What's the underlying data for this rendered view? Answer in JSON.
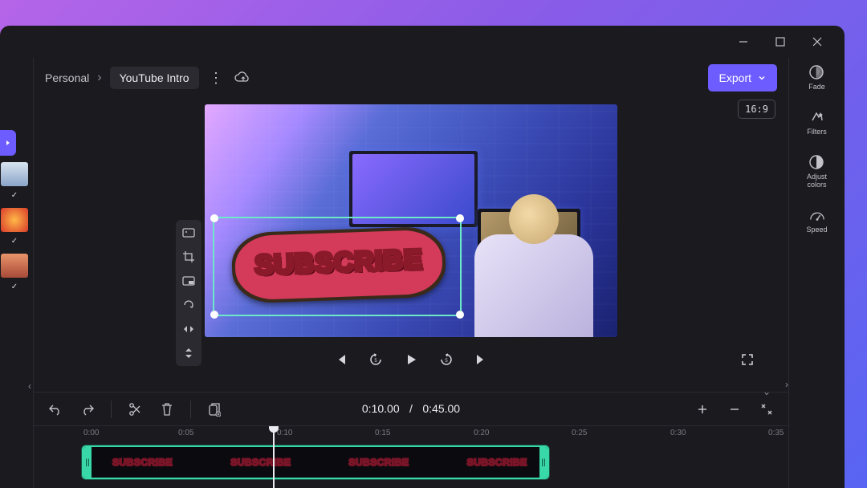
{
  "breadcrumb": {
    "root": "Personal",
    "current": "YouTube Intro"
  },
  "export_label": "Export",
  "aspect_ratio": "16:9",
  "sticker_text": "SUBSCRIBE",
  "playback": {
    "current": "0:10.00",
    "separator": "/",
    "total": "0:45.00"
  },
  "right_panel": {
    "fade": "Fade",
    "filters": "Filters",
    "adjust": "Adjust\ncolors",
    "speed": "Speed"
  },
  "timeline": {
    "ticks": [
      "0:00",
      "0:05",
      "0:10",
      "0:15",
      "0:20",
      "0:25",
      "0:30",
      "0:35"
    ]
  },
  "clip_mini_text": "SUBSCRIBE"
}
